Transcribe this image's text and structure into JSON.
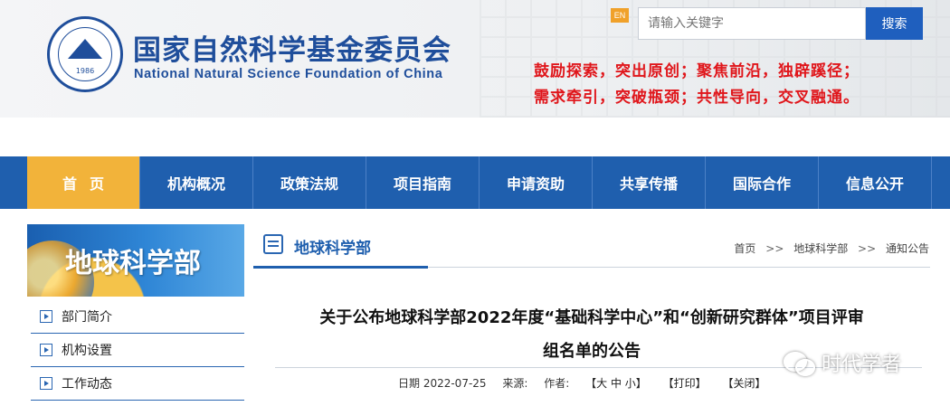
{
  "header": {
    "org_cn": "国家自然科学基金委员会",
    "org_en": "National Natural Science Foundation of China",
    "emblem_year": "1986",
    "en_label": "EN",
    "search_placeholder": "请输入关键字",
    "search_button": "搜索",
    "slogan_line1": "鼓励探索，突出原创；聚焦前沿，独辟蹊径；",
    "slogan_line2": "需求牵引，突破瓶颈；共性导向，交叉融通。"
  },
  "nav": {
    "items": [
      {
        "label": "首页"
      },
      {
        "label": "机构概况"
      },
      {
        "label": "政策法规"
      },
      {
        "label": "项目指南"
      },
      {
        "label": "申请资助"
      },
      {
        "label": "共享传播"
      },
      {
        "label": "国际合作"
      },
      {
        "label": "信息公开"
      }
    ]
  },
  "sidebar": {
    "banner_title": "地球科学部",
    "items": [
      {
        "label": "部门简介"
      },
      {
        "label": "机构设置"
      },
      {
        "label": "工作动态"
      }
    ]
  },
  "main": {
    "section_title": "地球科学部",
    "breadcrumb": [
      "首页",
      "地球科学部",
      "通知公告"
    ],
    "breadcrumb_sep": ">>",
    "article_title_line1": "关于公布地球科学部2022年度“基础科学中心”和“创新研究群体”项目评审",
    "article_title_line2": "组名单的公告",
    "meta": {
      "date_label": "日期 2022-07-25",
      "source_label": "来源:",
      "author_label": "作者:",
      "font_sizes": "【大 中 小】",
      "print": "【打印】",
      "close": "【关闭】"
    }
  },
  "watermark": {
    "text": "时代学者",
    "icon": "wechat-icon"
  },
  "colors": {
    "brand_blue": "#1f5fae",
    "nav_active": "#f2b33a",
    "slogan_red": "#e0161b"
  }
}
